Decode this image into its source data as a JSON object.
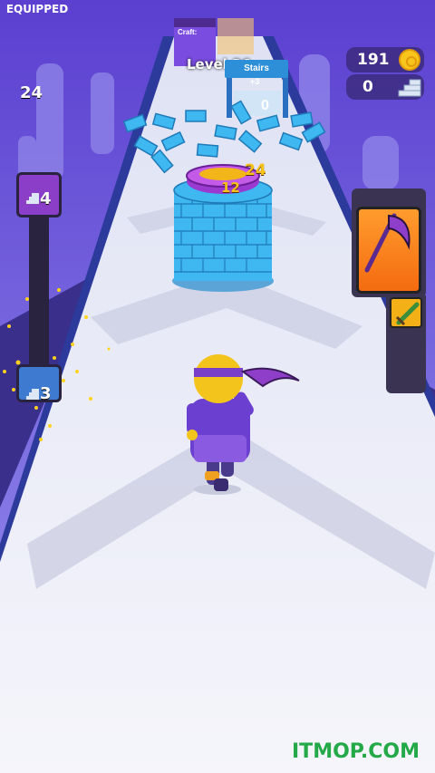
{
  "hud": {
    "coins": "191",
    "stairs": "0"
  },
  "track": {
    "level_label": "Level 36",
    "craft_label": "Craft:",
    "stairs_sign": "Stairs",
    "stairs_bonus": "+3",
    "stairs_sign_count": "0"
  },
  "tower": {
    "top_number": "24",
    "ring_number": "12"
  },
  "left_meter": {
    "top_count": "4",
    "bottom_count": "3"
  },
  "equipped": {
    "title": "EQUIPPED",
    "weapon_count": "24",
    "weapon_icon": "scythe-icon",
    "secondary_icon": "sword-icon"
  },
  "watermark": "ITMOP.COM",
  "colors": {
    "sky": "#6b4fd8",
    "track": "#eef0f8",
    "bricks": "#3fb7f0",
    "coin": "#f8c51c",
    "equipped_card": "#f47e1a",
    "watermark": "#24a948"
  }
}
